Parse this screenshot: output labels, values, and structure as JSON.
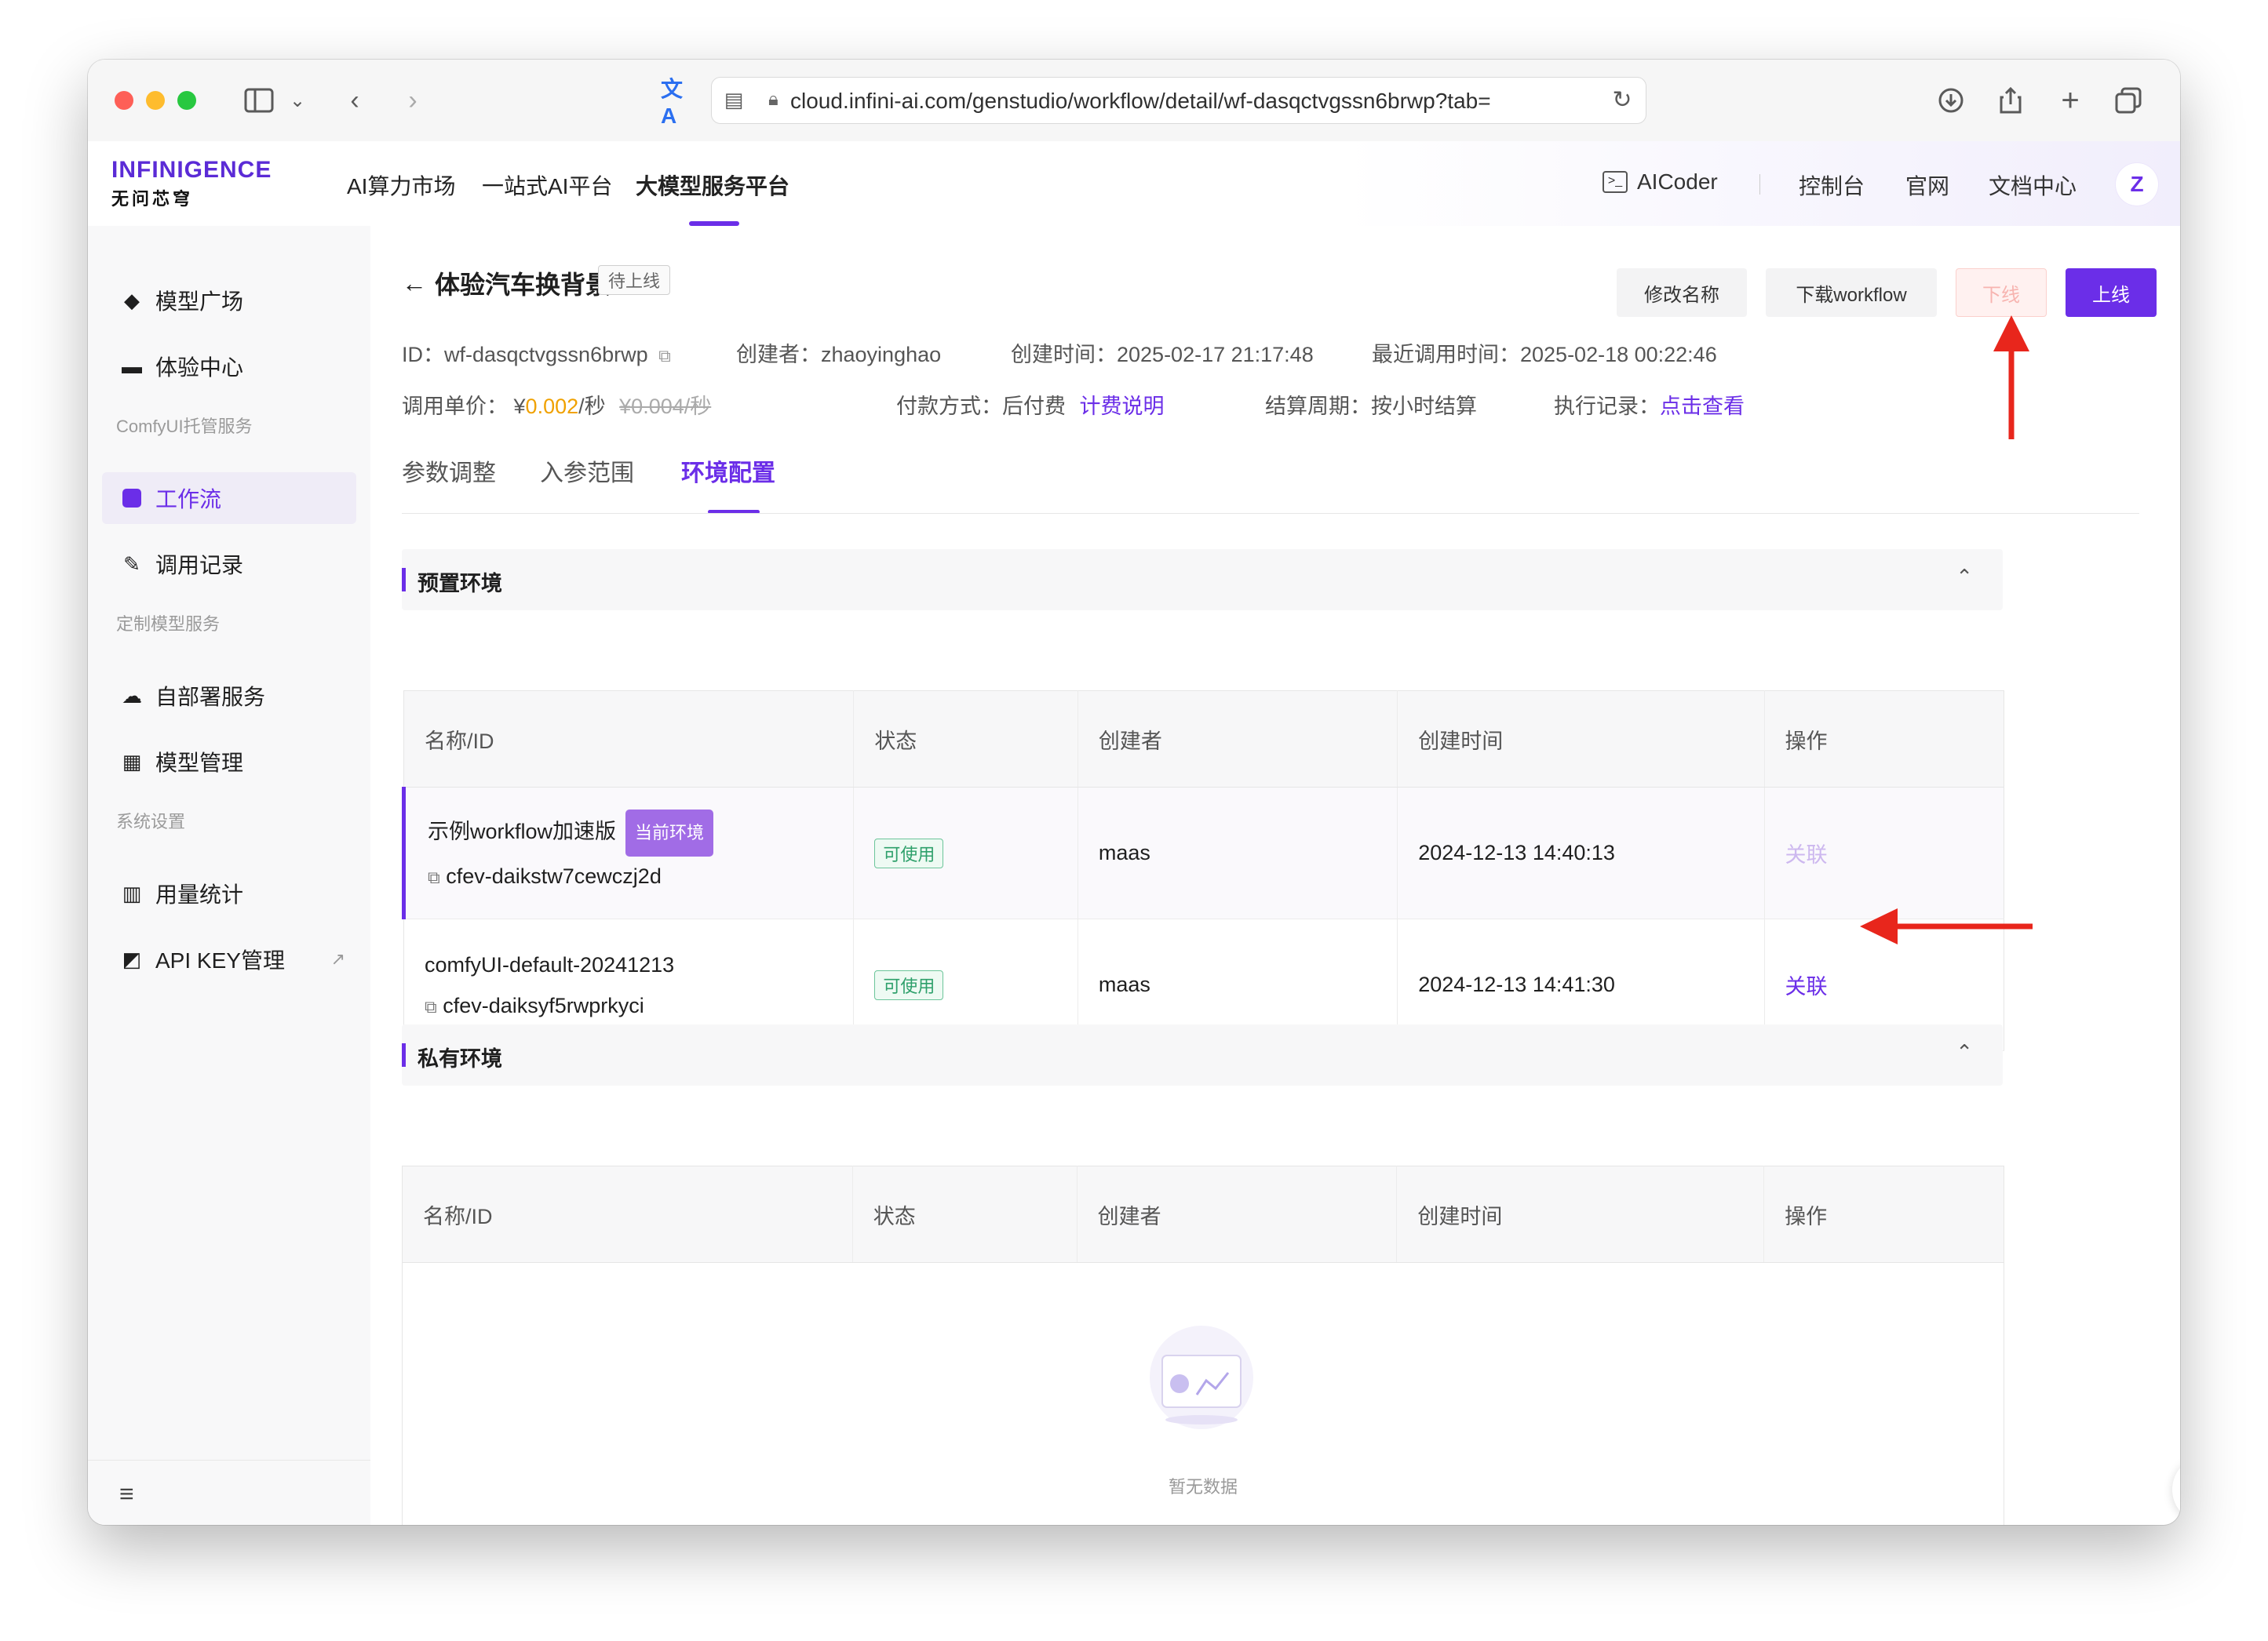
{
  "browser": {
    "url": "cloud.infini-ai.com/genstudio/workflow/detail/wf-dasqctvgssn6brwp?tab="
  },
  "header": {
    "logo_top": "INFINIGENCE",
    "logo_bottom": "无问芯穹",
    "nav": [
      "AI算力市场",
      "一站式AI平台",
      "大模型服务平台"
    ],
    "aicoder": "AICoder",
    "console": "控制台",
    "official": "官网",
    "docs": "文档中心",
    "avatar": "Z"
  },
  "sidebar": {
    "items": [
      {
        "label": "模型广场"
      },
      {
        "label": "体验中心"
      },
      {
        "label": "工作流"
      },
      {
        "label": "调用记录"
      },
      {
        "label": "自部署服务"
      },
      {
        "label": "模型管理"
      },
      {
        "label": "用量统计"
      },
      {
        "label": "API KEY管理"
      }
    ],
    "groups": [
      "ComfyUI托管服务",
      "定制模型服务",
      "系统设置"
    ]
  },
  "page": {
    "title": "体验汽车换背景",
    "status_tag": "待上线",
    "buttons": {
      "rename": "修改名称",
      "download": "下载workflow",
      "offline": "下线",
      "online": "上线"
    },
    "meta": {
      "id_label": "ID：",
      "id": "wf-dasqctvgssn6brwp",
      "creator_label": "创建者：",
      "creator": "zhaoyinghao",
      "created_label": "创建时间：",
      "created": "2025-02-17 21:17:48",
      "last_call_label": "最近调用时间：",
      "last_call": "2025-02-18 00:22:46",
      "price_label": "调用单价：",
      "price_currency": "¥",
      "price": "0.002",
      "price_unit": "/秒",
      "old_price": "¥0.004/秒",
      "pay_label": "付款方式：",
      "pay": "后付费",
      "pay_link": "计费说明",
      "cycle_label": "结算周期：",
      "cycle": "按小时结算",
      "exec_label": "执行记录：",
      "exec_link": "点击查看"
    },
    "tabs": [
      "参数调整",
      "入参范围",
      "环境配置"
    ]
  },
  "preset": {
    "title": "预置环境",
    "headers": [
      "名称/ID",
      "状态",
      "创建者",
      "创建时间",
      "操作"
    ],
    "rows": [
      {
        "name": "示例workflow加速版",
        "badge": "当前环境",
        "id": "cfev-daikstw7cewczj2d",
        "status": "可使用",
        "creator": "maas",
        "time": "2024-12-13 14:40:13",
        "action": "关联"
      },
      {
        "name": "comfyUI-default-20241213",
        "id": "cfev-daiksyf5rwprkyci",
        "status": "可使用",
        "creator": "maas",
        "time": "2024-12-13 14:41:30",
        "action": "关联"
      }
    ]
  },
  "private": {
    "title": "私有环境",
    "headers": [
      "名称/ID",
      "状态",
      "创建者",
      "创建时间",
      "操作"
    ],
    "empty": "暂无数据"
  },
  "colors": {
    "accent": "#6b2ee8",
    "price": "#f0a100",
    "annotation": "#e8261c"
  }
}
